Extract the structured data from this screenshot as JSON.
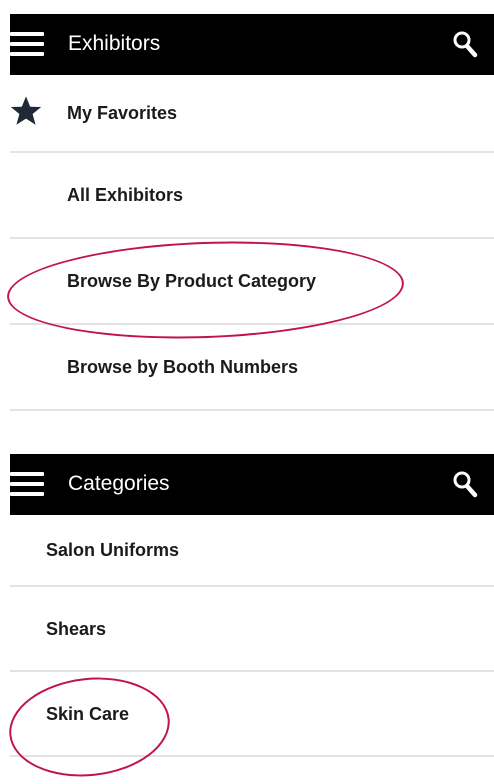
{
  "screen1": {
    "header": {
      "title": "Exhibitors",
      "menu_icon": "hamburger-menu-icon",
      "search_icon": "search-icon"
    },
    "items": [
      {
        "label": "My Favorites",
        "icon": "star-icon"
      },
      {
        "label": "All Exhibitors"
      },
      {
        "label": "Browse By Product Category"
      },
      {
        "label": "Browse by Booth Numbers"
      }
    ]
  },
  "screen2": {
    "header": {
      "title": "Categories",
      "menu_icon": "hamburger-menu-icon",
      "search_icon": "search-icon"
    },
    "items": [
      {
        "label": "Salon Uniforms"
      },
      {
        "label": "Shears"
      },
      {
        "label": "Skin Care"
      }
    ]
  },
  "colors": {
    "appbar": "#000000",
    "highlight_circle": "#c0144a",
    "divider": "#e3e3e3"
  }
}
